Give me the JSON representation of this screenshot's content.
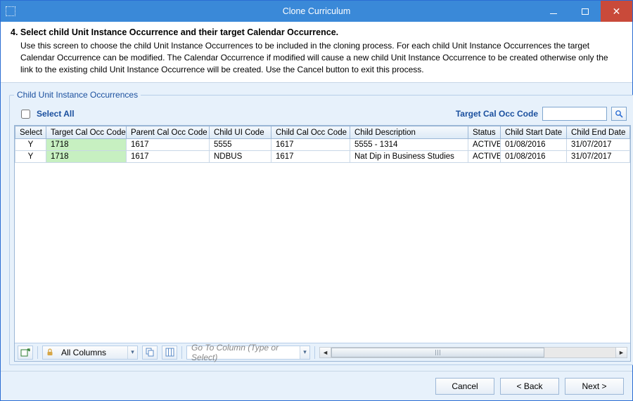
{
  "window": {
    "title": "Clone Curriculum"
  },
  "header": {
    "step_title": "4. Select child Unit Instance Occurrence and their target Calendar Occurrence.",
    "description": "Use this screen to choose the child Unit Instance Occurrences to be included in the cloning process.  For each child Unit Instance Occurrences the target Calendar Occurrence can be modified. The Calendar Occurrence if modified will cause a new child Unit Instance Occurrence to be created otherwise only the link to the existing child Unit Instance Occurrence will be created. Use the Cancel button to exit this process."
  },
  "group": {
    "legend": "Child Unit Instance Occurrences"
  },
  "controls": {
    "select_all_label": "Select All",
    "target_search_label": "Target Cal Occ Code",
    "target_search_value": "",
    "all_columns_label": "All Columns",
    "goto_placeholder": "Go To Column (Type or Select)"
  },
  "grid": {
    "columns": [
      "Select",
      "Target Cal Occ Code",
      "Parent Cal Occ Code",
      "Child UI Code",
      "Child Cal Occ Code",
      "Child Description",
      "Status",
      "Child Start Date",
      "Child End Date"
    ],
    "rows": [
      {
        "select": "Y",
        "target": "1718",
        "parent": "1617",
        "ui": "5555",
        "child_occ": "1617",
        "desc": "5555 - 1314",
        "status": "ACTIVE",
        "start": "01/08/2016",
        "end": "31/07/2017"
      },
      {
        "select": "Y",
        "target": "1718",
        "parent": "1617",
        "ui": "NDBUS",
        "child_occ": "1617",
        "desc": "Nat Dip in Business Studies",
        "status": "ACTIVE",
        "start": "01/08/2016",
        "end": "31/07/2017"
      }
    ]
  },
  "footer": {
    "cancel": "Cancel",
    "back": "< Back",
    "next": "Next >"
  }
}
